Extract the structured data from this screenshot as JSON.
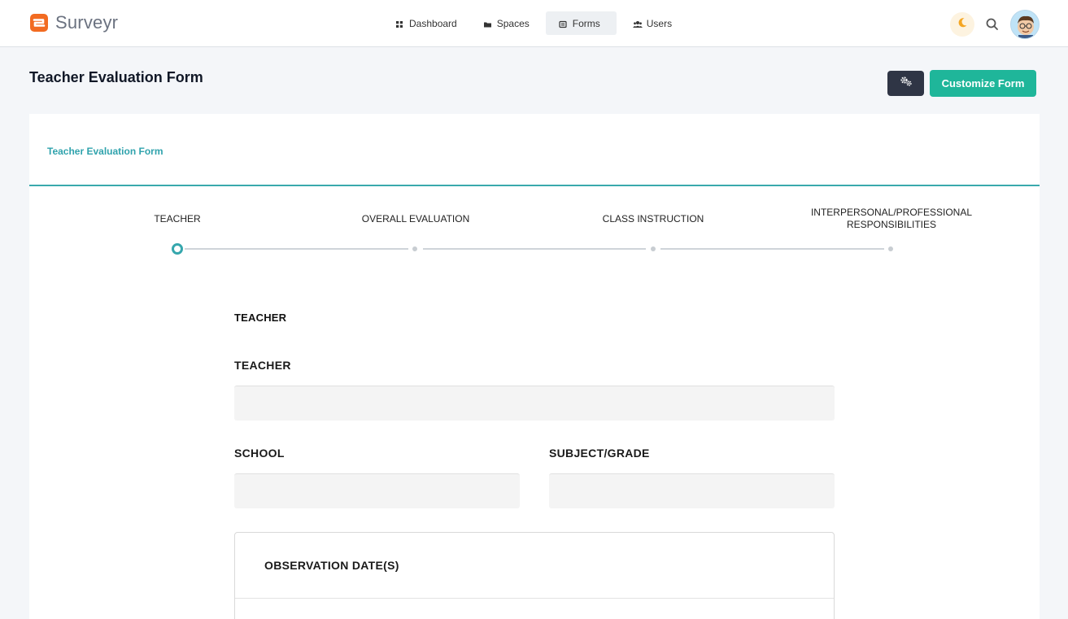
{
  "app": {
    "name": "Surveyr",
    "brand_color": "#f26b21"
  },
  "nav": {
    "items": [
      {
        "label": "Dashboard",
        "icon": "grid-icon"
      },
      {
        "label": "Spaces",
        "icon": "folder-icon"
      },
      {
        "label": "Forms",
        "icon": "form-icon",
        "active": true
      },
      {
        "label": "Users",
        "icon": "users-icon"
      }
    ]
  },
  "header": {
    "title": "Teacher Evaluation Form",
    "customize_label": "Customize Form"
  },
  "card": {
    "title": "Teacher Evaluation Form",
    "accent": "#30a3ad"
  },
  "stepper": {
    "steps": [
      {
        "label": "TEACHER",
        "active": true
      },
      {
        "label": "OVERALL EVALUATION",
        "active": false
      },
      {
        "label": "CLASS INSTRUCTION",
        "active": false
      },
      {
        "label": "INTERPERSONAL/PROFESSIONAL RESPONSIBILITIES",
        "active": false
      }
    ]
  },
  "form": {
    "section_title": "TEACHER",
    "fields": {
      "teacher": {
        "label": "TEACHER",
        "value": ""
      },
      "school": {
        "label": "SCHOOL",
        "value": ""
      },
      "subject_grade": {
        "label": "SUBJECT/GRADE",
        "value": ""
      }
    },
    "observation": {
      "title": "OBSERVATION DATE(S)"
    }
  }
}
